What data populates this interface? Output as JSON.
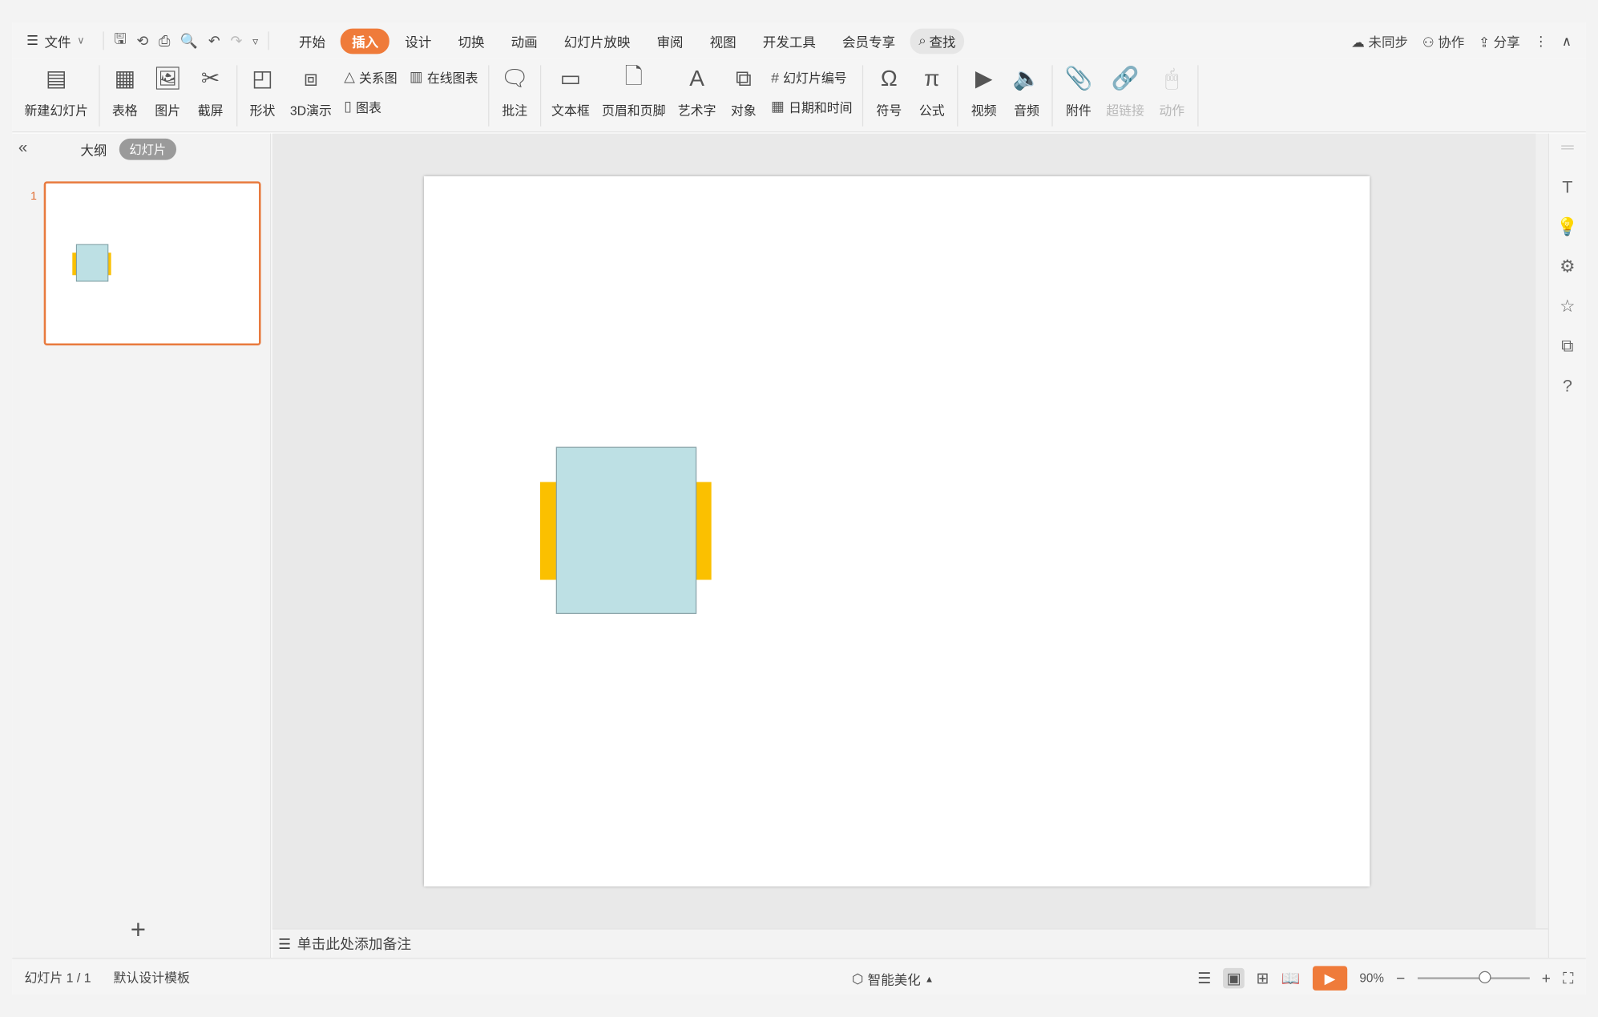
{
  "menubar": {
    "file_label": "文件",
    "tabs": [
      {
        "label": "开始"
      },
      {
        "label": "插入",
        "active": true
      },
      {
        "label": "设计"
      },
      {
        "label": "切换"
      },
      {
        "label": "动画"
      },
      {
        "label": "幻灯片放映"
      },
      {
        "label": "审阅"
      },
      {
        "label": "视图"
      },
      {
        "label": "开发工具"
      },
      {
        "label": "会员专享"
      }
    ],
    "find_label": "查找",
    "unsync_label": "未同步",
    "collab_label": "协作",
    "share_label": "分享"
  },
  "ribbon": {
    "new_slide": "新建幻灯片",
    "table": "表格",
    "picture": "图片",
    "screenshot": "截屏",
    "shape": "形状",
    "demo3d": "3D演示",
    "relation": "关系图",
    "online_chart": "在线图表",
    "chart": "图表",
    "comment": "批注",
    "textbox": "文本框",
    "header_footer": "页眉和页脚",
    "wordart": "艺术字",
    "object": "对象",
    "slide_number": "幻灯片编号",
    "datetime": "日期和时间",
    "symbol": "符号",
    "formula": "公式",
    "video": "视频",
    "audio": "音频",
    "attachment": "附件",
    "hyperlink": "超链接",
    "action": "动作"
  },
  "leftpanel": {
    "outline_tab": "大纲",
    "slides_tab": "幻灯片",
    "slide_number": "1"
  },
  "notes": {
    "placeholder": "单击此处添加备注"
  },
  "status": {
    "slide_count": "幻灯片 1 / 1",
    "template": "默认设计模板",
    "beautify": "智能美化",
    "zoom": "90%"
  },
  "colors": {
    "accent": "#ef7b3a",
    "shape_fill": "#bde0e4",
    "shape_side": "#fbc000"
  }
}
